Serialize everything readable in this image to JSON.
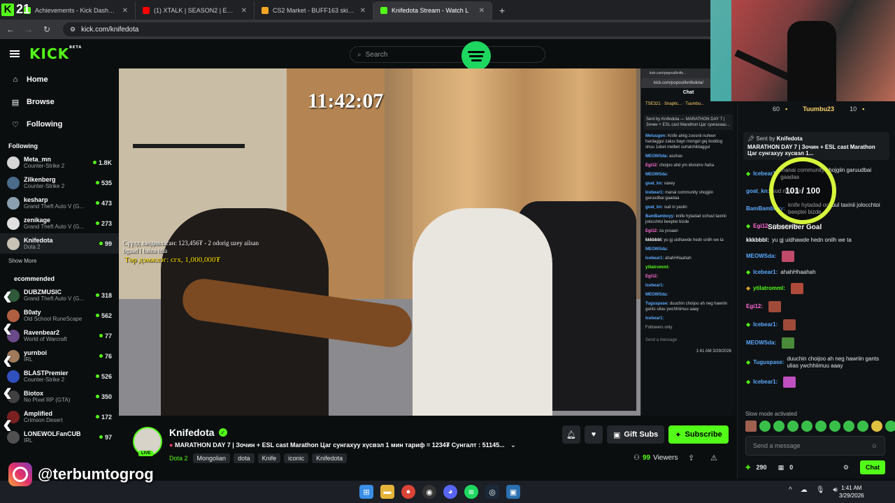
{
  "browser": {
    "tabs": [
      {
        "label": "Achievements - Kick Dashboard",
        "color": "#53fc18",
        "active": false
      },
      {
        "label": "(1) XTALK | SEASON2 | EP2 - DE",
        "color": "#ff0000",
        "active": false
      },
      {
        "label": "CS2 Market - BUFF163 skin trad",
        "color": "#f5a623",
        "active": false
      },
      {
        "label": "Knifedota Stream - Watch L",
        "color": "#53fc18",
        "active": true
      }
    ],
    "url": "kick.com/knifedota",
    "overlay_number": "21"
  },
  "header": {
    "logo": "KICK",
    "logo_badge": "BETA",
    "search_placeholder": "Search"
  },
  "sidebar": {
    "nav": [
      {
        "label": "Home",
        "icon": "home-icon",
        "glyph": "⌂"
      },
      {
        "label": "Browse",
        "icon": "browse-icon",
        "glyph": "▤"
      },
      {
        "label": "Following",
        "icon": "heart-icon",
        "glyph": "♡"
      }
    ],
    "following_title": "Following",
    "following": [
      {
        "name": "Meta_mn",
        "game": "Counter-Strike 2",
        "viewers": "1.8K",
        "color": "#d6d6d6"
      },
      {
        "name": "Zilkenberg",
        "game": "Counter-Strike 2",
        "viewers": "535",
        "color": "#4a6b8a"
      },
      {
        "name": "kesharp",
        "game": "Grand Theft Auto V (G...",
        "viewers": "473",
        "color": "#8aa0b0"
      },
      {
        "name": "zenikage",
        "game": "Grand Theft Auto V (G...",
        "viewers": "273",
        "color": "#e0e0e0"
      },
      {
        "name": "Knifedota",
        "game": "Dota 2",
        "viewers": "99",
        "color": "#c9c3b6"
      }
    ],
    "show_more": "Show More",
    "recommended_title": "ecommended",
    "recommended": [
      {
        "name": "DUBZMUSIC",
        "game": "Grand Theft Auto V (G...",
        "viewers": "318",
        "color": "#2e5a3a"
      },
      {
        "name": "B0aty",
        "game": "Old School RuneScape",
        "viewers": "562",
        "color": "#b06040"
      },
      {
        "name": "Ravenbear2",
        "game": "World of Warcraft",
        "viewers": "77",
        "color": "#6b4a8a"
      },
      {
        "name": "yurnboi",
        "game": "IRL",
        "viewers": "76",
        "color": "#a07a5a"
      },
      {
        "name": "BLASTPremier",
        "game": "Counter-Strike 2",
        "viewers": "526",
        "color": "#3050c0"
      },
      {
        "name": "Biotox",
        "game": "No Pixel RP (GTA)",
        "viewers": "350",
        "color": "#404040"
      },
      {
        "name": "Amplified",
        "game": "Crimson Desert",
        "viewers": "172",
        "color": "#7a2020"
      },
      {
        "name": "LONEWOLFanCUB",
        "game": "IRL",
        "viewers": "97",
        "color": "#505050"
      }
    ]
  },
  "player": {
    "timer": "11:42:07",
    "overlay_text": "Сүүлд хандивласан: 123,456₮ - 2 odorig uzey ailsan bgaad l baina hha",
    "overlay_goal": "Төр дэмжлэг: сгх, 1,000,000₮"
  },
  "popout": {
    "tab": "kick.com/popout/knife...",
    "url": "kick.com/popout/knifedota/",
    "title": "Chat",
    "gifters": "TSE321 · Snaptic... · Tuumbu...",
    "pinned": "Sent by Knifedota — MARATHON DAY 7 | Зочин + ESL cast Marathon Цаг сунгахаас...",
    "messages": [
      {
        "user": "Metuugen:",
        "text": "Knife ahiig zoosnii nuheer hardaggui zaluu bayn mongol gej boddog shuu 1xbet melbet surtalchildaggui",
        "color": "#5aa9ff"
      },
      {
        "user": "MEOWSda:",
        "text": "asshas",
        "color": "#5aa9ff"
      },
      {
        "user": "Egi12:",
        "text": "choijoo ahd ym idvisimv haha",
        "color": "#ff6bd6"
      },
      {
        "user": "MEOWSda:",
        "text": "",
        "color": "#5aa9ff"
      },
      {
        "user": "goat_kn:",
        "text": "xaxey",
        "color": "#5aa9ff"
      },
      {
        "user": "Icebear1:",
        "text": "manai community shojgiin garuudbai gaadaa",
        "color": "#5aa9ff"
      },
      {
        "user": "goat_kn:",
        "text": "sud ni yaslin",
        "color": "#5aa9ff"
      },
      {
        "user": "BamBamboyy:",
        "text": "knife hytadad ochuul taxinii jolocchtoi beeptei bizde",
        "color": "#5aa9ff"
      },
      {
        "user": "Egi12:",
        "text": "za yvsaan",
        "color": "#ff6bd6"
      },
      {
        "user": "kkkbbbl:",
        "text": "yu gj uidhawde hedn onilh we ta",
        "color": "#ffffff"
      },
      {
        "user": "MEOWSda:",
        "text": "",
        "color": "#5aa9ff"
      },
      {
        "user": "Icebear1:",
        "text": "ahahHhaahah",
        "color": "#5aa9ff"
      },
      {
        "user": "ytilatromml:",
        "text": "",
        "color": "#53fc18"
      },
      {
        "user": "Egi12:",
        "text": "",
        "color": "#ff6bd6"
      },
      {
        "user": "Icebear1:",
        "text": "",
        "color": "#5aa9ff"
      },
      {
        "user": "MEOWSda:",
        "text": "",
        "color": "#5aa9ff"
      },
      {
        "user": "Tuguspase:",
        "text": "duuchin choijoo ah neg hawriin gants ulias ywchhiimuu aaay",
        "color": "#5aa9ff"
      },
      {
        "user": "Icebear1:",
        "text": "",
        "color": "#5aa9ff"
      }
    ],
    "followers_only": "Followers only",
    "send_placeholder": "Send a message",
    "clock_time": "1:41 AM",
    "clock_date": "3/29/2026"
  },
  "stream": {
    "channel": "Knifedota",
    "live_label": "LIVE",
    "title": "MARATHON DAY 7 | Зочин + ESL cast Marathon Цаг сунгахуу хүсвэл 1 мин тариф = 1234₮  Сунгалт : 51145...",
    "category": "Dota 2",
    "tags": [
      "Mongolian",
      "dota",
      "Knife",
      "iconic",
      "Knifedota"
    ],
    "gift_label": "Gift Subs",
    "subscribe_label": "Subscribe",
    "viewers_count": "99",
    "viewers_label": "Viewers"
  },
  "chat": {
    "gifter1_count": "60",
    "gifter2_name": "Tuumbu23",
    "gifter2_count": "10",
    "pinned_by_label": "Sent by",
    "pinned_by": "Knifedota",
    "pinned_text": "MARATHON DAY 7 | Зочин + ESL cast Marathon Цаг сунгахуу хүсвэл 1...",
    "messages": [
      {
        "user": "Icebear1:",
        "text": "manai community shojgiin garuudbai gaadaa",
        "color": "#5aa9ff",
        "badge": "#53fc18"
      },
      {
        "user": "goat_kn:",
        "text": "sud ni yaslin",
        "color": "#5aa9ff",
        "badge": ""
      },
      {
        "user": "BamBamboyy:",
        "text": "knife hytadad ochuul taxinii jolocchtoi beeptei bizde",
        "color": "#5aa9ff",
        "badge": ""
      },
      {
        "user": "Egi12:",
        "text": "za yvsaan",
        "color": "#ff6bd6",
        "badge": "#53fc18"
      },
      {
        "user": "kkkbbbl:",
        "text": "yu gj uidhawde hedn onilh we ta",
        "color": "#ffffff",
        "badge": ""
      },
      {
        "user": "MEOWSda:",
        "text": "",
        "color": "#5aa9ff",
        "badge": "",
        "emote": "#c04a6a"
      },
      {
        "user": "Icebear1:",
        "text": "ahahHhaahah",
        "color": "#5aa9ff",
        "badge": "#53fc18"
      },
      {
        "user": "ytilatromml:",
        "text": "",
        "color": "#53fc18",
        "badge": "#d8a030",
        "emote": "#b04a3a"
      },
      {
        "user": "Egi12:",
        "text": "",
        "color": "#ff6bd6",
        "badge": "",
        "emote": "#a04a3a"
      },
      {
        "user": "Icebear1:",
        "text": "",
        "color": "#5aa9ff",
        "badge": "#53fc18",
        "emote": "#a04a3a"
      },
      {
        "user": "MEOWSda:",
        "text": "",
        "color": "#5aa9ff",
        "badge": "",
        "emote": "#4a8a3a"
      },
      {
        "user": "Tuguspase:",
        "text": "duuchin choijoo ah neg hawriin gants ulias ywchhiimuu aaay",
        "color": "#5aa9ff",
        "badge": "#53fc18"
      },
      {
        "user": "Icebear1:",
        "text": "",
        "color": "#5aa9ff",
        "badge": "#53fc18",
        "emote": "#c050c0"
      }
    ],
    "goal_value": "101 / 100",
    "goal_label": "Subscriber Goal",
    "slow_mode": "Slow mode activated",
    "input_placeholder": "Send a message",
    "points": "290",
    "store_count": "0",
    "send_label": "Chat"
  },
  "overlay": {
    "ig_handle": "@terbumtogrog"
  },
  "taskbar": {
    "time": "1:41 AM",
    "date": "3/29/2026"
  },
  "colors": {
    "kick_green": "#53fc18",
    "bg": "#0b0e0f",
    "panel": "#0f1214"
  }
}
